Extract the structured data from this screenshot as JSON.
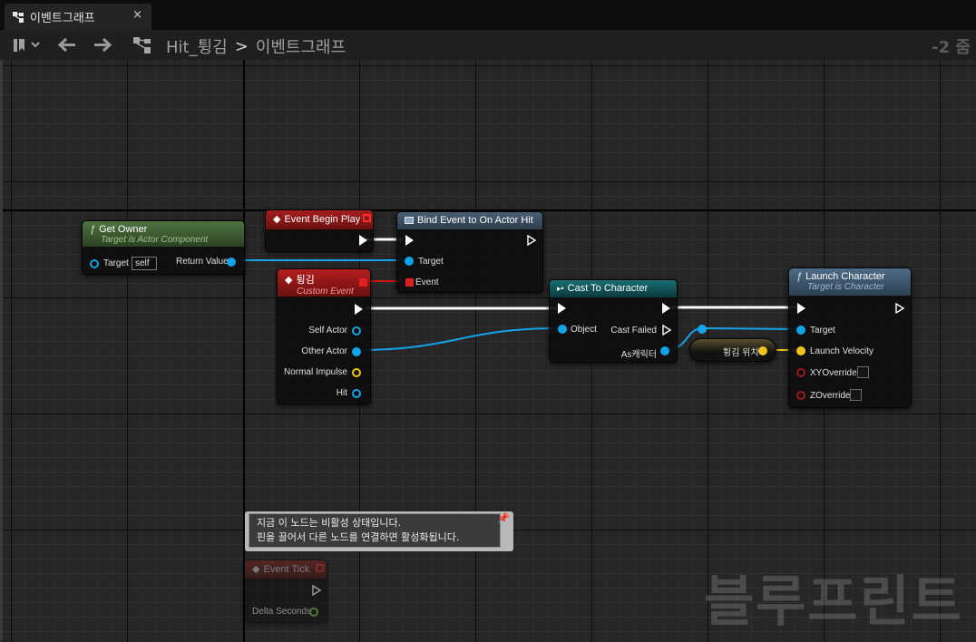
{
  "tab": {
    "title": "이벤트그래프",
    "close": "×"
  },
  "toolbar": {
    "crumb_root": "Hit_튕김",
    "crumb_sep": ">",
    "crumb_current": "이벤트그래프",
    "zoom": "-2 줌"
  },
  "nodes": {
    "get_owner": {
      "title": "Get Owner",
      "subtitle": "Target is Actor Component",
      "pin_target": "Target",
      "target_value": "self",
      "pin_return": "Return Value"
    },
    "begin_play": {
      "title": "Event Begin Play"
    },
    "bind_event": {
      "title": "Bind Event to On Actor Hit",
      "pin_target": "Target",
      "pin_event": "Event"
    },
    "custom_event": {
      "title": "튕김",
      "subtitle": "Custom Event",
      "pins": [
        "Self Actor",
        "Other Actor",
        "Normal Impulse",
        "Hit"
      ]
    },
    "cast": {
      "title": "Cast To Character",
      "pin_object": "Object",
      "pin_failed": "Cast Failed",
      "pin_as": "As캐릭터"
    },
    "variable": {
      "title": "튕김 위치"
    },
    "launch": {
      "title": "Launch Character",
      "subtitle": "Target is Character",
      "pins": [
        "Target",
        "Launch Velocity",
        "XYOverride",
        "ZOverride"
      ]
    },
    "event_tick": {
      "title": "Event Tick",
      "pin_delta": "Delta Seconds"
    }
  },
  "tooltip": {
    "line1": "지금 이 노드는 비활성 상태입니다.",
    "line2": "핀을 끌어서 다른 노드를 연결하면 활성화됩니다."
  },
  "watermark": "블루프린트",
  "colors": {
    "function_header": "#3f5b32",
    "event_header": "#8c1717",
    "cast_header": "#0f5358",
    "launch_header": "#3d5870",
    "object_pin": "#13a3e8",
    "vector_pin": "#f2c318"
  }
}
